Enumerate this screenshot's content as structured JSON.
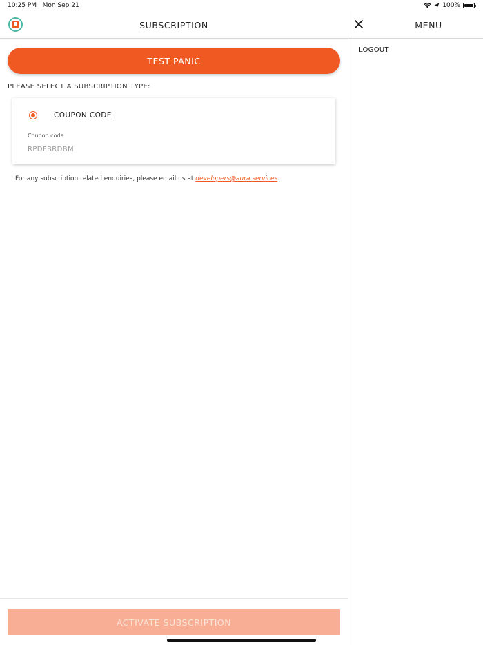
{
  "status_bar": {
    "time": "10:25 PM",
    "date": "Mon Sep 21",
    "battery": "100%"
  },
  "header": {
    "title": "SUBSCRIPTION"
  },
  "panic_button": {
    "label": "TEST PANIC"
  },
  "subscription": {
    "select_label": "PLEASE SELECT A SUBSCRIPTION TYPE:",
    "option_label": "COUPON CODE",
    "coupon_field_label": "Coupon code:",
    "coupon_value": "RPDFBRDBM"
  },
  "enquiry": {
    "text": "For any subscription related enquiries, please email us at ",
    "email": "developers@aura.services",
    "suffix": "."
  },
  "activate_button": {
    "label": "ACTIVATE SUBSCRIPTION"
  },
  "menu": {
    "title": "MENU",
    "items": [
      {
        "label": "LOGOUT"
      }
    ]
  },
  "colors": {
    "accent": "#f05a22",
    "accent_disabled": "#f8ae94",
    "logo_ring": "#4fb9a4"
  },
  "icons": {
    "logo": "aura-logo-icon",
    "close": "close-icon",
    "wifi": "wifi-icon",
    "location": "location-arrow-icon",
    "battery": "battery-icon",
    "radio": "radio-selected-icon"
  }
}
